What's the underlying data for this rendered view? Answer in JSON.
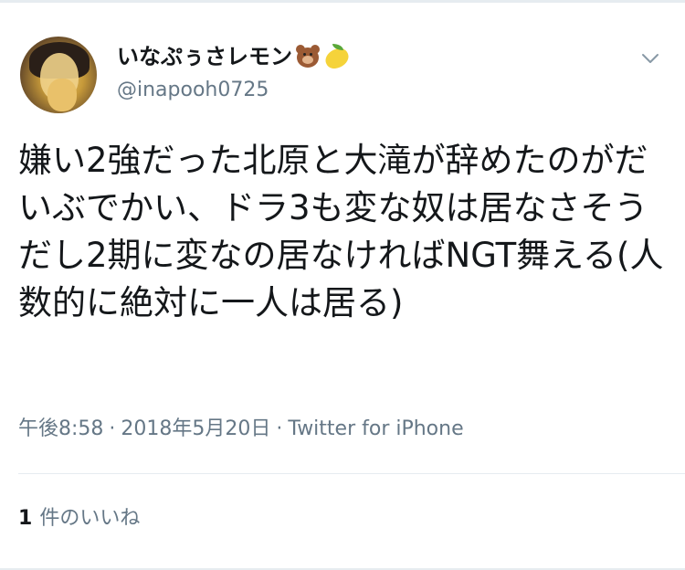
{
  "tweet": {
    "user": {
      "display_name": "いなぷぅさレモン",
      "name_emojis": [
        "bear-face",
        "lemon"
      ],
      "handle": "@inapooh0725"
    },
    "text": "嫌い2強だった北原と大滝が辞めたのがだいぶでかい、ドラ3も変な奴は居なさそうだし2期に変なの居なければNGT舞える(人数的に絶対に一人は居る)",
    "meta": {
      "time": "午後8:58",
      "separator": "·",
      "date": "2018年5月20日",
      "source": "Twitter for iPhone"
    },
    "likes": {
      "count": "1",
      "label": "件のいいね"
    }
  },
  "colors": {
    "text_primary": "#14171a",
    "text_secondary": "#657786",
    "divider": "#e6ecf0"
  }
}
